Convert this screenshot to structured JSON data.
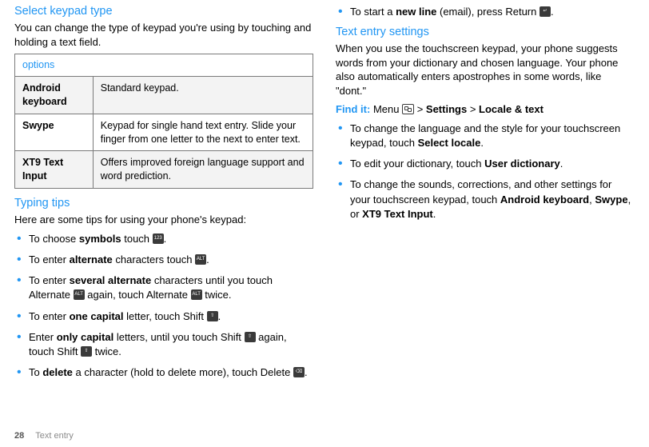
{
  "left": {
    "h1": "Select keypad type",
    "intro": "You can change the type of keypad you're using by touching and holding a text field.",
    "table_header": "options",
    "rows": [
      {
        "name": "Android keyboard",
        "desc": "Standard keypad."
      },
      {
        "name": "Swype",
        "desc": "Keypad for single hand text entry. Slide your finger from one letter to the next to enter text."
      },
      {
        "name": "XT9 Text Input",
        "desc": "Offers improved foreign language support and word prediction."
      }
    ],
    "h2": "Typing tips",
    "tips_intro": "Here are some tips for using your phone's keypad:",
    "tips": {
      "a_pre": "To choose ",
      "a_b": "symbols",
      "a_post": " touch ",
      "b_pre": "To enter ",
      "b_b": "alternate",
      "b_post": " characters touch ",
      "c_pre": "To enter ",
      "c_b": "several alternate",
      "c_mid": " characters until you touch Alternate ",
      "c_post": " again, touch Alternate ",
      "c_end": " twice.",
      "d_pre": "To enter ",
      "d_b": "one capital",
      "d_post": " letter, touch Shift ",
      "e_pre": "Enter ",
      "e_b": "only capital",
      "e_mid": " letters, until you touch Shift ",
      "e_post": " again, touch Shift ",
      "e_end": " twice.",
      "f_pre": "To ",
      "f_b": "delete",
      "f_post": " a character (hold to delete more), touch Delete "
    },
    "key_labels": {
      "num": "123",
      "alt": "ALT",
      "shift": "⇧",
      "del": "⌫",
      "enter": "↵"
    }
  },
  "right": {
    "top_pre": "To start a ",
    "top_b": "new line",
    "top_post": " (email), press Return ",
    "h1": "Text entry settings",
    "p1": "When you use the touchscreen keypad, your phone suggests words from your dictionary and chosen language. Your phone also automatically enters apostrophes in some words, like \"dont.\"",
    "findit": "Find it:",
    "findit_rest_1": " Menu ",
    "findit_rest_2": " > ",
    "findit_b1": "Settings",
    "findit_rest_3": " > ",
    "findit_b2": "Locale & text",
    "list": {
      "a_pre": "To change the language and the style for your touchscreen keypad, touch ",
      "a_b": "Select locale",
      "a_post": ".",
      "b_pre": "To edit your dictionary, touch ",
      "b_b": "User dictionary",
      "b_post": ".",
      "c_pre": "To change the sounds, corrections, and other settings for your touchscreen keypad, touch ",
      "c_b1": "Android keyboard",
      "c_sep1": ", ",
      "c_b2": "Swype",
      "c_sep2": ", or ",
      "c_b3": "XT9 Text Input",
      "c_post": "."
    }
  },
  "footer": {
    "page": "28",
    "section": "Text entry"
  }
}
